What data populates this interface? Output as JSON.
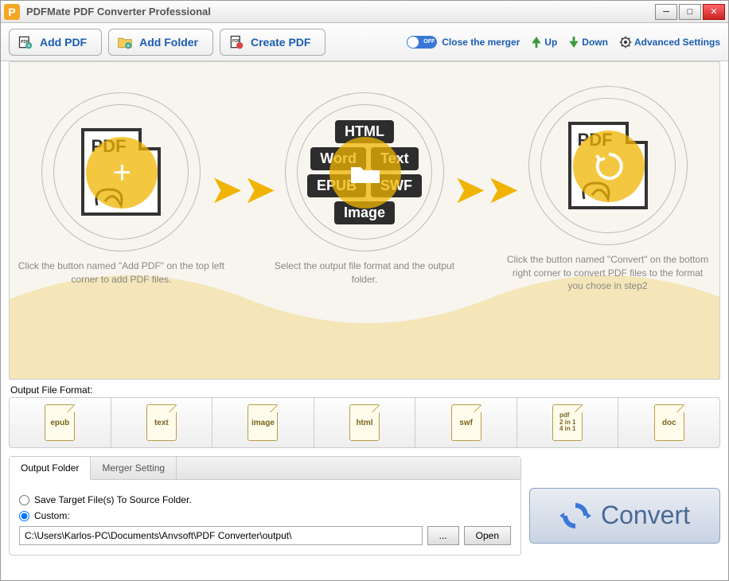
{
  "title": "PDFMate PDF Converter Professional",
  "toolbar": {
    "add_pdf": "Add PDF",
    "add_folder": "Add Folder",
    "create_pdf": "Create PDF",
    "close_merger": "Close the merger",
    "up": "Up",
    "down": "Down",
    "advanced": "Advanced Settings",
    "toggle_state": "OFF"
  },
  "stage": {
    "pdf_label": "PDF",
    "step1_desc": "Click the button named \"Add PDF\" on the top left corner to add PDF files.",
    "step2_desc": "Select the output file format and the output folder.",
    "step3_desc": "Click the button named \"Convert\" on the bottom right corner to convert PDF files to the format you chose in step2",
    "center_formats": {
      "row1": [
        "HTML"
      ],
      "row2": [
        "Word",
        "Text"
      ],
      "row3": [
        "EPUB",
        "SWF"
      ],
      "row4": [
        "Image"
      ]
    }
  },
  "output_format_label": "Output File Format:",
  "formats": [
    "epub",
    "text",
    "image",
    "html",
    "swf",
    "pdf\n2 in 1\n4 in 1",
    "doc"
  ],
  "bottom": {
    "tab1": "Output Folder",
    "tab2": "Merger Setting",
    "radio1": "Save Target File(s) To Source Folder.",
    "radio2": "Custom:",
    "path": "C:\\Users\\Karlos-PC\\Documents\\Anvsoft\\PDF Converter\\output\\",
    "browse": "...",
    "open": "Open"
  },
  "convert_label": "Convert"
}
